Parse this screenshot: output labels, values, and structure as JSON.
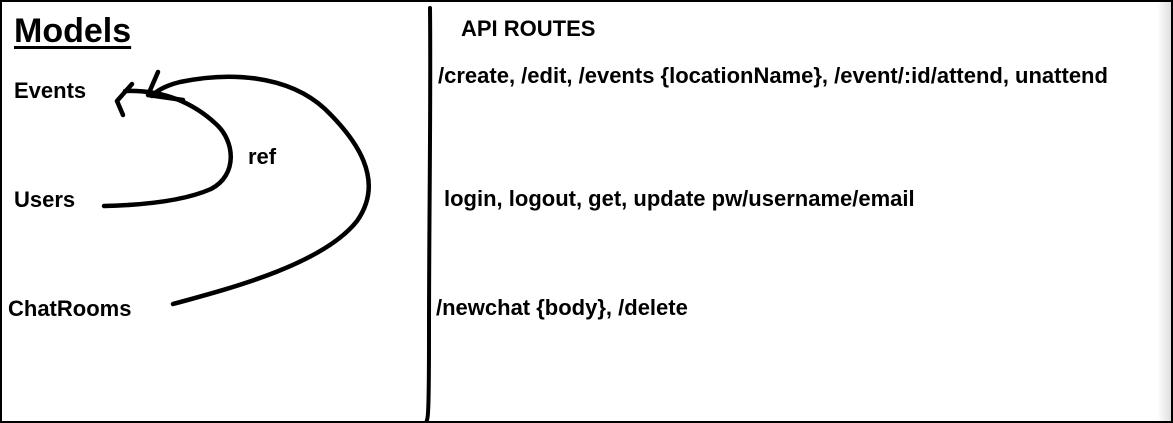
{
  "models": {
    "title": "Models",
    "items": {
      "events": "Events",
      "users": "Users",
      "chatrooms": "ChatRooms"
    },
    "ref_label": "ref"
  },
  "api": {
    "title": "API ROUTES",
    "routes": {
      "events": "/create, /edit, /events {locationName}, /event/:id/attend, unattend",
      "users": "login, logout, get, update pw/username/email",
      "chatrooms": "/newchat {body}, /delete"
    }
  },
  "ink_color": "#000000"
}
